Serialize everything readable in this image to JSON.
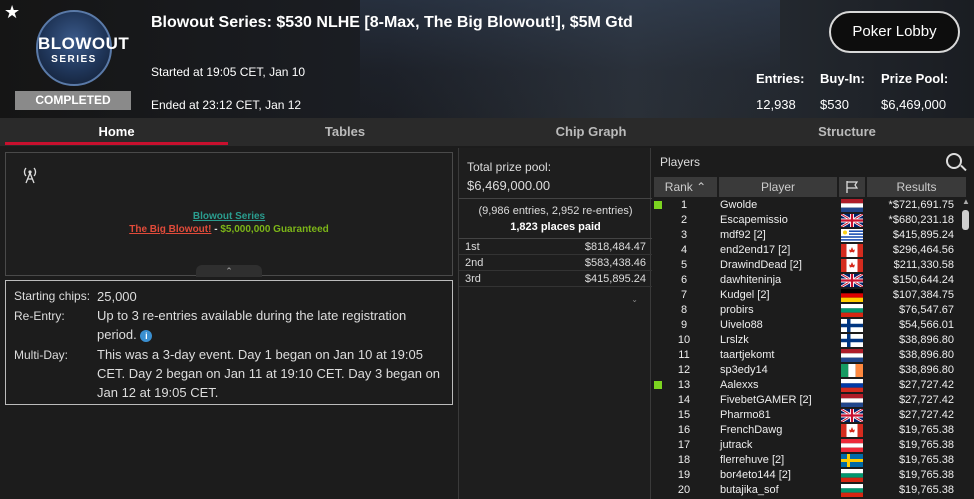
{
  "header": {
    "title": "Blowout Series: $530 NLHE [8-Max, The Big Blowout!], $5M Gtd",
    "logo_line1": "BLOWOUT",
    "logo_line2": "SERIES",
    "status_badge": "COMPLETED",
    "started": "Started at 19:05 CET, Jan 10",
    "ended": "Ended at 23:12 CET, Jan 12",
    "lobby_button": "Poker Lobby",
    "entries_label": "Entries:",
    "entries_value": "12,938",
    "buyin_label": "Buy-In:",
    "buyin_value": "$530",
    "prizepool_label": "Prize Pool:",
    "prizepool_value": "$6,469,000"
  },
  "tabs": [
    {
      "label": "Home"
    },
    {
      "label": "Tables"
    },
    {
      "label": "Chip Graph"
    },
    {
      "label": "Structure"
    }
  ],
  "banner": {
    "line1": "Blowout Series",
    "line2_a": "The Big Blowout!",
    "line2_sep": " - ",
    "line2_b": "$5,000,000 Guaranteed"
  },
  "details": {
    "chips_label": "Starting chips:",
    "chips_value": "25,000",
    "reentry_label": "Re-Entry:",
    "reentry_value": "Up to 3 re-entries available during the late registration period.",
    "multiday_label": "Multi-Day:",
    "multiday_value": "This was a 3-day event. Day 1 began on Jan 10 at 19:05 CET. Day 2 began on Jan 11 at 19:10 CET. Day 3 began on Jan 12 at 19:05 CET."
  },
  "prize": {
    "title": "Total prize pool:",
    "amount": "$6,469,000.00",
    "entries": "(9,986 entries, 2,952 re-entries)",
    "places": "1,823 places paid",
    "rows": [
      {
        "place": "1st",
        "amount": "$818,484.47"
      },
      {
        "place": "2nd",
        "amount": "$583,438.46"
      },
      {
        "place": "3rd",
        "amount": "$415,895.24"
      }
    ]
  },
  "players": {
    "title": "Players",
    "col_rank": "Rank",
    "col_player": "Player",
    "col_results": "Results",
    "rows": [
      {
        "rank": "1",
        "name": "Gwolde",
        "result": "*$721,691.75",
        "flag": "nl",
        "dot": true
      },
      {
        "rank": "2",
        "name": "Escapemissio",
        "result": "*$680,231.18",
        "flag": "gb",
        "dot": false
      },
      {
        "rank": "3",
        "name": "mdf92 [2]",
        "result": "$415,895.24",
        "flag": "uy",
        "dot": false
      },
      {
        "rank": "4",
        "name": "end2end17 [2]",
        "result": "$296,464.56",
        "flag": "ca",
        "dot": false
      },
      {
        "rank": "5",
        "name": "DrawindDead [2]",
        "result": "$211,330.58",
        "flag": "ca",
        "dot": false
      },
      {
        "rank": "6",
        "name": "dawhiteninja",
        "result": "$150,644.24",
        "flag": "gb",
        "dot": false
      },
      {
        "rank": "7",
        "name": "Kudgel [2]",
        "result": "$107,384.75",
        "flag": "de",
        "dot": false
      },
      {
        "rank": "8",
        "name": "probirs",
        "result": "$76,547.67",
        "flag": "bg",
        "dot": false
      },
      {
        "rank": "9",
        "name": "Uivelo88",
        "result": "$54,566.01",
        "flag": "fi",
        "dot": false
      },
      {
        "rank": "10",
        "name": "Lrslzk",
        "result": "$38,896.80",
        "flag": "fi",
        "dot": false
      },
      {
        "rank": "11",
        "name": "taartjekomt",
        "result": "$38,896.80",
        "flag": "nl",
        "dot": false
      },
      {
        "rank": "12",
        "name": "sp3edy14",
        "result": "$38,896.80",
        "flag": "ie",
        "dot": false
      },
      {
        "rank": "13",
        "name": "Aalexxs",
        "result": "$27,727.42",
        "flag": "ru",
        "dot": true
      },
      {
        "rank": "14",
        "name": "FivebetGAMER [2]",
        "result": "$27,727.42",
        "flag": "nl",
        "dot": false
      },
      {
        "rank": "15",
        "name": "Pharmo81",
        "result": "$27,727.42",
        "flag": "gb",
        "dot": false
      },
      {
        "rank": "16",
        "name": "FrenchDawg",
        "result": "$19,765.38",
        "flag": "ca",
        "dot": false
      },
      {
        "rank": "17",
        "name": "jutrack",
        "result": "$19,765.38",
        "flag": "at",
        "dot": false
      },
      {
        "rank": "18",
        "name": "flerrehuve [2]",
        "result": "$19,765.38",
        "flag": "se",
        "dot": false
      },
      {
        "rank": "19",
        "name": "bor4eto144 [2]",
        "result": "$19,765.38",
        "flag": "bg",
        "dot": false
      },
      {
        "rank": "20",
        "name": "butajika_sof",
        "result": "$19,765.38",
        "flag": "bg",
        "dot": false
      }
    ]
  },
  "colors": {
    "accent_red": "#c8102e",
    "status_green": "#7cd420",
    "info_blue": "#3a8fd0"
  }
}
